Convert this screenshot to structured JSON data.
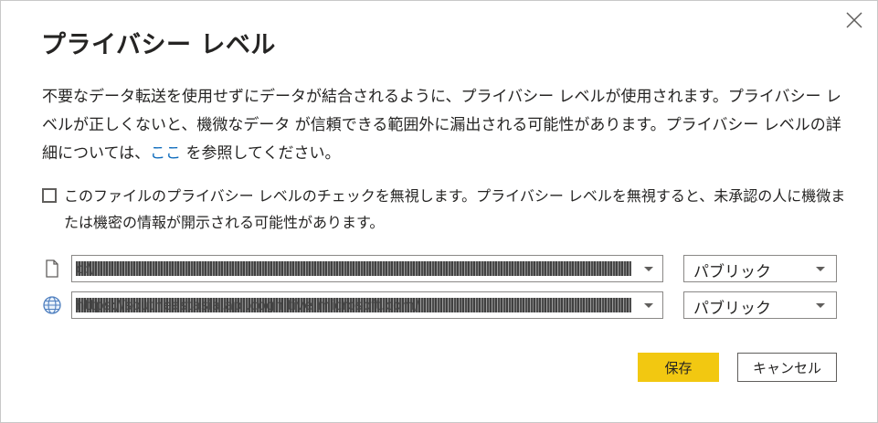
{
  "dialog": {
    "title": "プライバシー レベル",
    "description": {
      "part1": "不要なデータ転送を使用せずにデータが結合されるように、プライバシー レベルが使用されます。プライバシー レベルが正しくないと、機微なデータ が信頼できる範囲外に漏出される可能性があります。プライバシー レベルの詳細については、",
      "link": "ここ",
      "part2": " を参照してください。"
    },
    "ignore_checkbox": {
      "label": "このファイルのプライバシー レベルのチェックを無視します。プライバシー レベルを無視すると、未承認の人に機微または機密の情報が開示される可能性があります。",
      "checked": false
    },
    "sources": [
      {
        "icon": "file-icon",
        "path": "c:\\",
        "level": "パブリック"
      },
      {
        "icon": "globe-icon",
        "path": "https://southeastasia.api.cognitive.microsoft.com/",
        "level": "パブリック"
      }
    ],
    "buttons": {
      "save": "保存",
      "cancel": "キャンセル"
    },
    "colors": {
      "accent": "#f2c811",
      "link": "#0f6cbd"
    }
  }
}
